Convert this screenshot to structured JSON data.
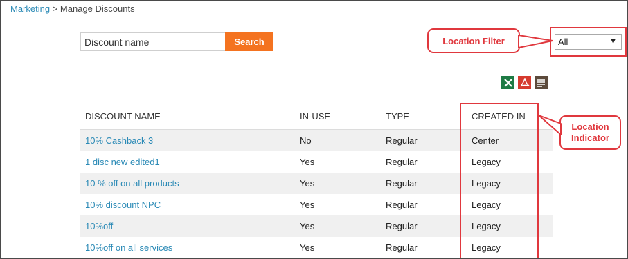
{
  "breadcrumb": {
    "parent": "Marketing",
    "separator": ">",
    "current": "Manage Discounts"
  },
  "search": {
    "value": "Discount name",
    "placeholder": "Discount name",
    "button_label": "Search"
  },
  "location_filter": {
    "selected": "All"
  },
  "callouts": {
    "filter_label": "Location Filter",
    "indicator_label_1": "Location",
    "indicator_label_2": "Indicator"
  },
  "exports": [
    "excel-export-icon",
    "pdf-export-icon",
    "text-export-icon"
  ],
  "colors": {
    "accent": "#f47320",
    "link": "#2b8ab6",
    "annotation": "#e0383e"
  },
  "table": {
    "columns": [
      "DISCOUNT NAME",
      "IN-USE",
      "TYPE",
      "CREATED IN"
    ],
    "rows": [
      {
        "name": "10% Cashback 3",
        "in_use": "No",
        "type": "Regular",
        "created_in": "Center"
      },
      {
        "name": "1 disc new edited1",
        "in_use": "Yes",
        "type": "Regular",
        "created_in": "Legacy"
      },
      {
        "name": "10 % off on all products",
        "in_use": "Yes",
        "type": "Regular",
        "created_in": "Legacy"
      },
      {
        "name": "10% discount NPC",
        "in_use": "Yes",
        "type": "Regular",
        "created_in": "Legacy"
      },
      {
        "name": "10%off",
        "in_use": "Yes",
        "type": "Regular",
        "created_in": "Legacy"
      },
      {
        "name": "10%off on all services",
        "in_use": "Yes",
        "type": "Regular",
        "created_in": "Legacy"
      }
    ]
  }
}
